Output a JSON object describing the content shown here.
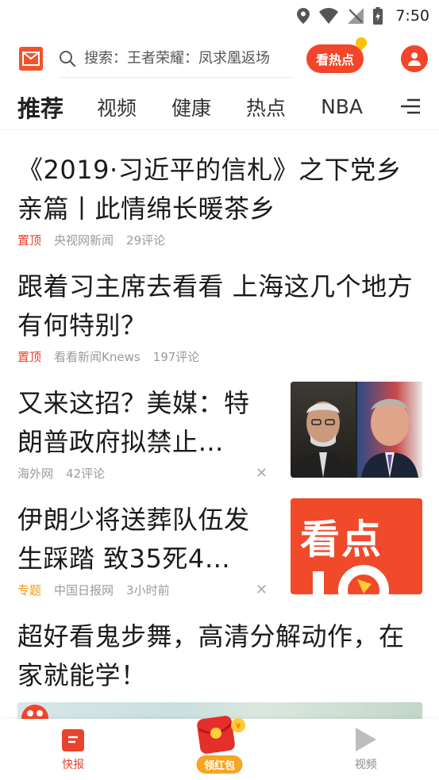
{
  "status_bar": {
    "time": "7:50"
  },
  "top_bar": {
    "search_placeholder": "搜索：王者荣耀：凤求凰返场",
    "hot_button_label": "看热点"
  },
  "channels": [
    {
      "label": "推荐",
      "active": true
    },
    {
      "label": "视频"
    },
    {
      "label": "健康"
    },
    {
      "label": "热点"
    },
    {
      "label": "NBA"
    }
  ],
  "articles": [
    {
      "title": "《2019·习近平的信札》之下党乡亲篇丨此情绵长暖茶乡",
      "tag": "置顶",
      "source": "央视网新闻",
      "comments": "29评论"
    },
    {
      "title": "跟着习主席去看看 上海这几个地方有何特别？",
      "tag": "置顶",
      "source": "看看新闻Knews",
      "comments": "197评论"
    },
    {
      "title": "又来这招？美媒：特朗普政府拟禁止…",
      "source": "海外网",
      "comments": "42评论"
    },
    {
      "title": "伊朗少将送葬队伍发生踩踏 致35死4…",
      "tag": "专题",
      "source": "中国日报网",
      "time": "3小时前",
      "thumb_text": "看点"
    },
    {
      "title": "超好看鬼步舞，高清分解动作，在家就能学！"
    }
  ],
  "bottom_nav": {
    "items": [
      {
        "label": "快报",
        "active": true
      },
      {
        "label": "领红包"
      },
      {
        "label": "视频"
      }
    ]
  }
}
